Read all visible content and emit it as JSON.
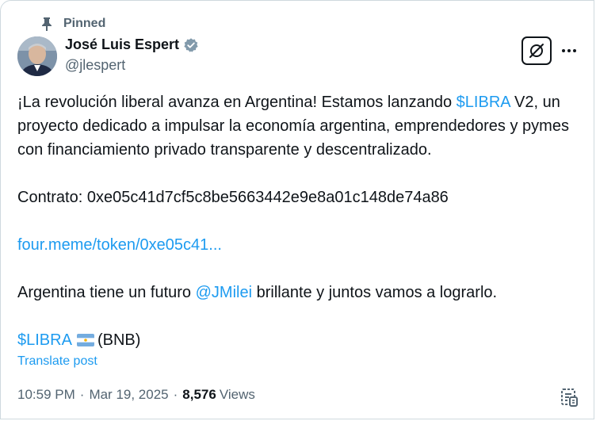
{
  "pinned": {
    "label": "Pinned",
    "icon": "pin-icon"
  },
  "author": {
    "name": "José Luis Espert",
    "handle": "@jlespert",
    "verified_icon": "verified-badge-icon",
    "verified_color": "#829aab"
  },
  "actions": {
    "grok_icon": "grok-icon",
    "more_icon": "more-icon"
  },
  "post": {
    "p1_text": "¡La revolución liberal avanza en Argentina! Estamos lanzando ",
    "p1_cashtag": "$LIBRA",
    "p1_rest": " V2, un proyecto dedicado a impulsar la economía argentina, emprendedores y pymes con financiamiento privado transparente y descentralizado.",
    "contract": "Contrato: 0xe05c41d7cf5c8be5663442e9e8a01c148de74a86",
    "link": "four.meme/token/0xe05c41...",
    "p4_text": "Argentina tiene un futuro ",
    "p4_mention": "@JMilei",
    "p4_rest": " brillante y juntos vamos a lograrlo.",
    "p5_cashtag": "$LIBRA",
    "p5_flag_icon": "argentina-flag-icon",
    "p5_rest": "(BNB)"
  },
  "translate_label": "Translate post",
  "meta": {
    "time": "10:59 PM",
    "separator": "·",
    "date": "Mar 19, 2025",
    "views_count": "8,576",
    "views_label": "Views"
  },
  "colors": {
    "link": "#1d9bf0",
    "secondary": "#536471",
    "primary": "#0f1419",
    "border": "#cfd9de"
  }
}
